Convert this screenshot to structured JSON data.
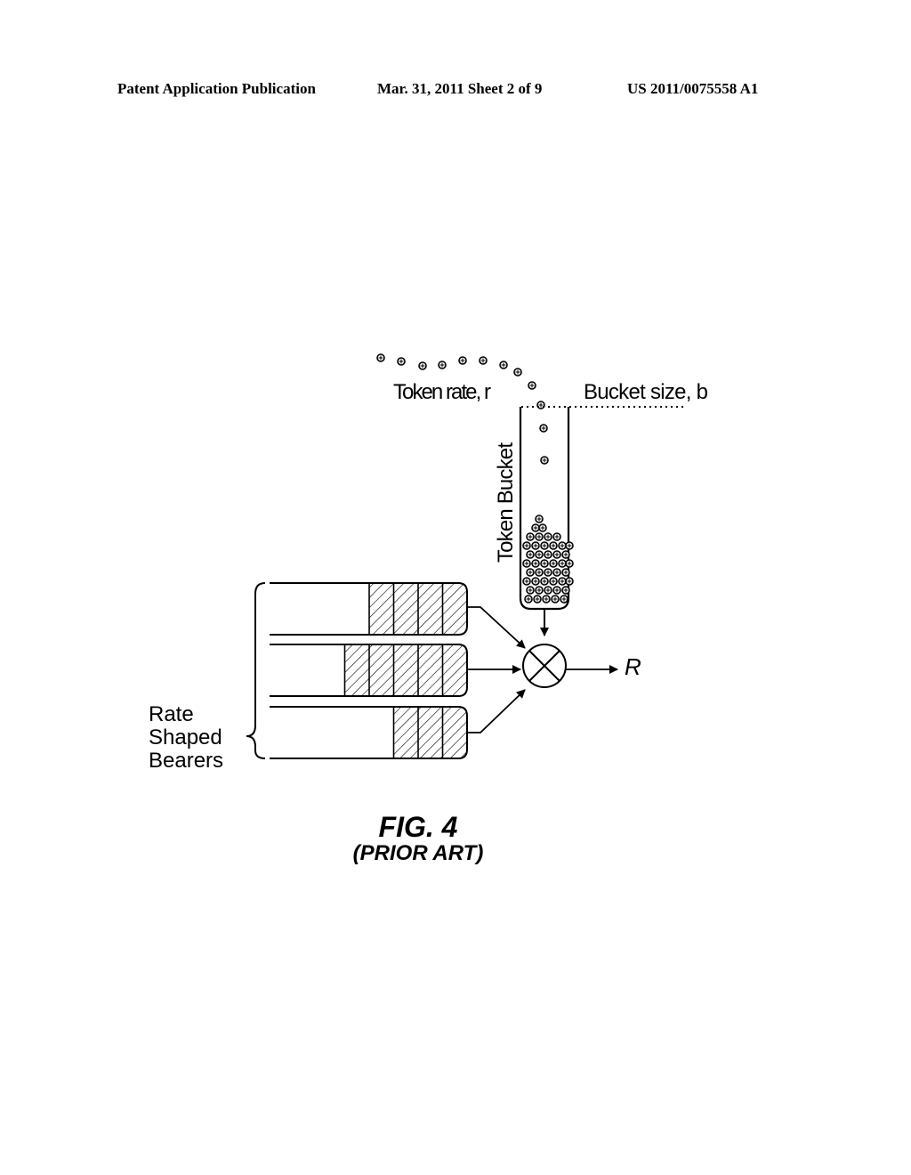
{
  "header": {
    "publication": "Patent Application Publication",
    "date_sheet": "Mar. 31, 2011  Sheet 2 of 9",
    "number": "US 2011/0075558 A1"
  },
  "figure": {
    "token_rate_label": "Token rate, r",
    "bucket_size_label": "Bucket size, b",
    "token_bucket_label": "Token Bucket",
    "bearers_label_line1": "Rate",
    "bearers_label_line2": "Shaped",
    "bearers_label_line3": "Bearers",
    "output_label": "R",
    "caption": "FIG. 4",
    "subcaption": "(PRIOR ART)",
    "bearer_queues": [
      {
        "packets": 4
      },
      {
        "packets": 5
      },
      {
        "packets": 3
      }
    ],
    "combiner_symbol": "multiplier-circle"
  }
}
